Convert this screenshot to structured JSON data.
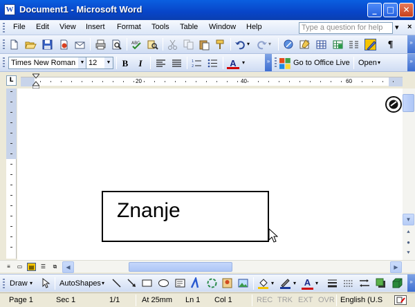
{
  "window": {
    "title": "Document1 - Microsoft Word",
    "app_icon_glyph": "W"
  },
  "menu": {
    "items": [
      "File",
      "Edit",
      "View",
      "Insert",
      "Format",
      "Tools",
      "Table",
      "Window",
      "Help"
    ],
    "help_placeholder": "Type a question for help"
  },
  "formatting": {
    "font_name": "Times New Roman",
    "font_size": "12",
    "bold": "B",
    "italic": "I",
    "font_color_glyph": "A",
    "office_live": "Go to Office Live",
    "open": "Open"
  },
  "ruler": {
    "numbers": [
      "20",
      "40",
      "60"
    ],
    "tab_selector": "L"
  },
  "document": {
    "textbox_text": "Znanje"
  },
  "drawing": {
    "draw": "Draw",
    "autoshapes": "AutoShapes"
  },
  "status": {
    "page": "Page 1",
    "section": "Sec 1",
    "pages": "1/1",
    "at": "At 25mm",
    "line": "Ln 1",
    "col": "Col 1",
    "rec": "REC",
    "trk": "TRK",
    "ext": "EXT",
    "ovr": "OVR",
    "language": "English (U.S"
  },
  "colors": {
    "titlebar": "#0a5fe0",
    "highlight": "#f5c400",
    "font_color_bar": "#d00000"
  }
}
